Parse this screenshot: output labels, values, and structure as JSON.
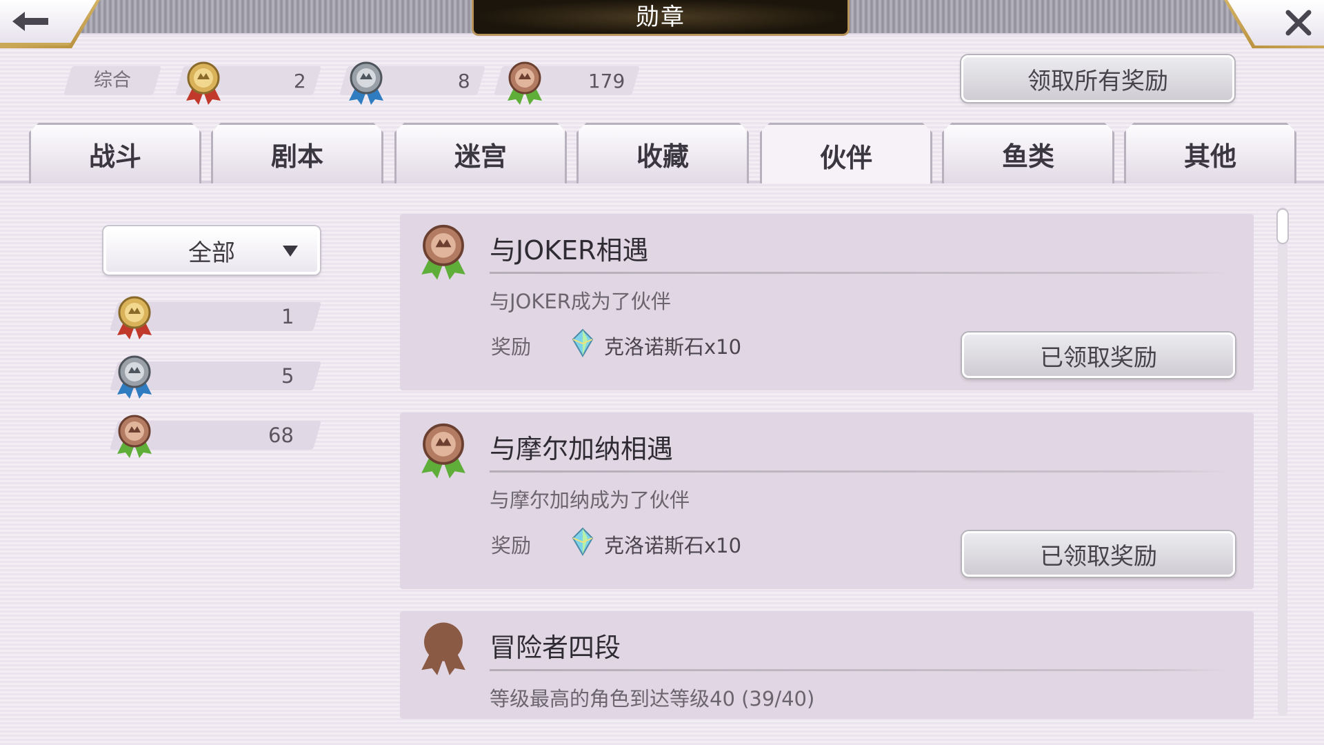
{
  "header": {
    "title": "勋章",
    "back_icon": "arrow-left-icon",
    "close_icon": "close-icon"
  },
  "summary": {
    "label": "综合",
    "gold_count": "2",
    "silver_count": "8",
    "bronze_count": "179",
    "claim_all_label": "领取所有奖励"
  },
  "tabs": [
    {
      "label": "战斗"
    },
    {
      "label": "剧本"
    },
    {
      "label": "迷宫"
    },
    {
      "label": "收藏"
    },
    {
      "label": "伙伴"
    },
    {
      "label": "鱼类"
    },
    {
      "label": "其他"
    }
  ],
  "active_tab": "伙伴",
  "filter": {
    "selected": "全部",
    "gold_count": "1",
    "silver_count": "5",
    "bronze_count": "68"
  },
  "achievements": [
    {
      "title": "与JOKER相遇",
      "description": "与JOKER成为了伙伴",
      "reward_label": "奖励",
      "reward": "克洛诺斯石x10",
      "button_label": "已领取奖励"
    },
    {
      "title": "与摩尔加纳相遇",
      "description": "与摩尔加纳成为了伙伴",
      "reward_label": "奖励",
      "reward": "克洛诺斯石x10",
      "button_label": "已领取奖励"
    },
    {
      "title": "冒险者四段",
      "description": "等级最高的角色到达等级40 (39/40)"
    }
  ],
  "colors": {
    "gold_medal": "#d9b25a",
    "silver_medal": "#9aa0a8",
    "bronze_medal": "#b27b62",
    "red_ribbon": "#c0392b",
    "blue_ribbon": "#2f7cc0",
    "green_ribbon": "#5fae3a",
    "locked_medal": "#8b5a45"
  }
}
